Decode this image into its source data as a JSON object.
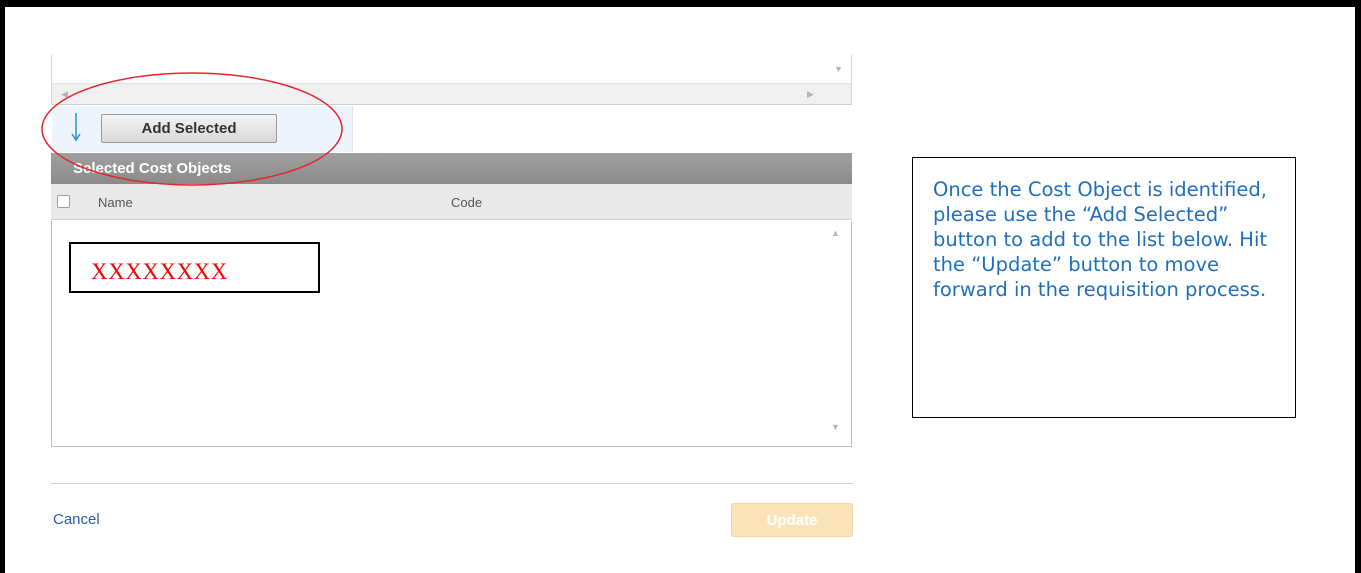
{
  "add_selected": {
    "label": "Add Selected"
  },
  "selected_panel": {
    "title": "Selected Cost Objects",
    "columns": [
      "Name",
      "Code"
    ],
    "rows": [
      {
        "name": "XXXXXXXX",
        "code": ""
      }
    ]
  },
  "footer": {
    "cancel_label": "Cancel",
    "update_label": "Update"
  },
  "callout": {
    "text": "Once the Cost Object is identified, please use the “Add Selected” button to add to the list below. Hit the “Update” button to move forward in the requisition process."
  },
  "colors": {
    "callout_text": "#1f6fbf",
    "annotation": "#e5242b",
    "header_bar": "#8f8f8f",
    "update_disabled": "#fbe3b9",
    "link": "#2a5db0"
  },
  "icons": {
    "down_arrow": "arrow-down-icon",
    "scroll_left": "triangle-left",
    "scroll_right": "triangle-right",
    "scroll_up": "triangle-up",
    "scroll_down": "triangle-down"
  }
}
